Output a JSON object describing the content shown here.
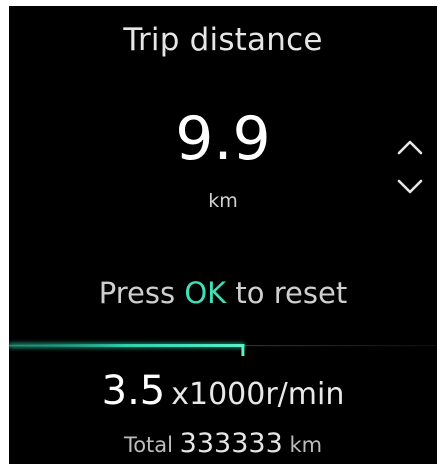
{
  "screen": {
    "title": "Trip distance",
    "value": "9.9",
    "unit": "km",
    "hint": {
      "prefix": "Press ",
      "key": "OK",
      "suffix": " to reset"
    },
    "rpm": {
      "value": "3.5",
      "unit": "x1000r/min",
      "bar_fraction": 0.55
    },
    "total": {
      "label": "Total",
      "value": "333333",
      "unit": "km"
    },
    "icons": {
      "up": "chevron-up-icon",
      "down": "chevron-down-icon"
    },
    "colors": {
      "background": "#000000",
      "accent": "#3fe0b8"
    }
  }
}
